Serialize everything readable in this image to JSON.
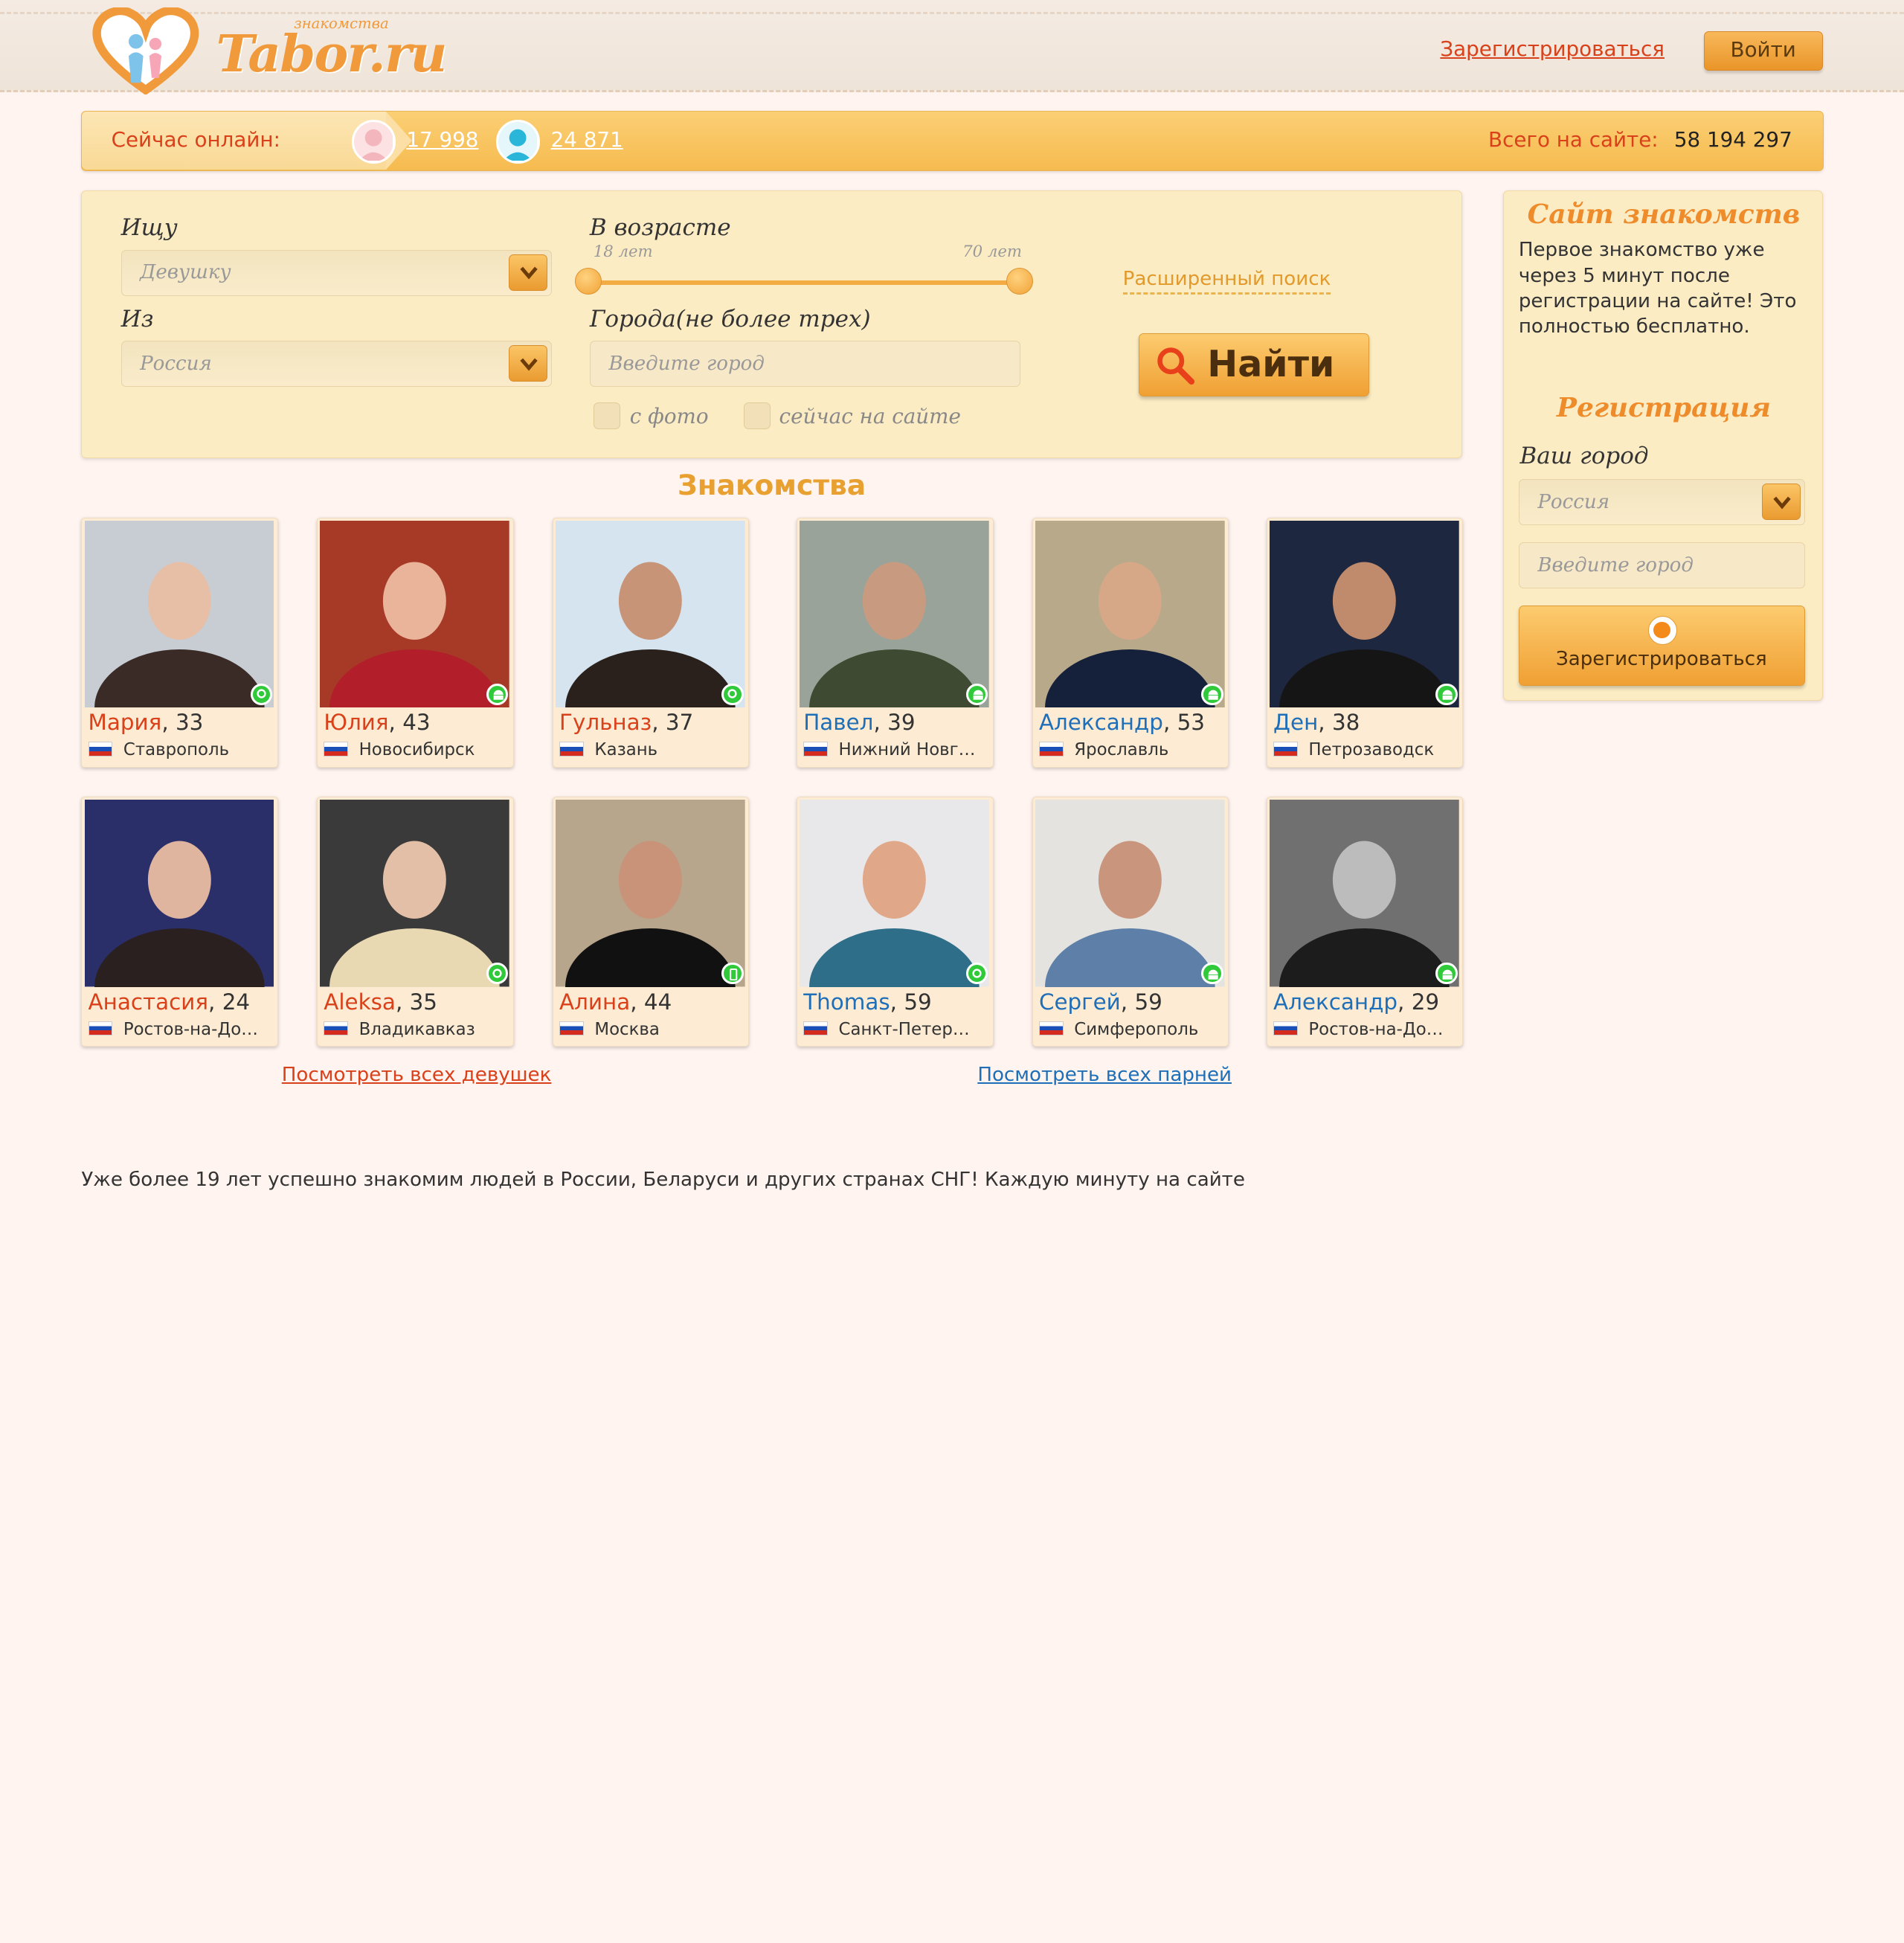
{
  "header": {
    "logo_word": "Tabor.ru",
    "logo_small": "знакомства",
    "register_link": "Зарегистрироваться",
    "login_button": "Войти"
  },
  "online_bar": {
    "label": "Сейчас онлайн:",
    "women_count": "17 998",
    "men_count": "24 871",
    "total_label": "Всего на сайте:",
    "total_value": "58 194 297"
  },
  "search": {
    "looking_label": "Ищу",
    "looking_value": "Девушку",
    "from_label": "Из",
    "from_value": "Россия",
    "age_label": "В возрасте",
    "age_min": "18 лет",
    "age_max": "70 лет",
    "cities_label": "Города(не более трех)",
    "city_placeholder": "Введите город",
    "with_photo": "с фото",
    "online_now": "сейчас на сайте",
    "advanced_link": "Расширенный поиск",
    "find_button": "Найти"
  },
  "section_title": "Знакомства",
  "profiles_row1": [
    {
      "name": "Мария",
      "age": ", 33",
      "city": "Ставрополь",
      "gender": "f",
      "status": "online"
    },
    {
      "name": "Юлия",
      "age": ", 43",
      "city": "Новосибирск",
      "gender": "f",
      "status": "android"
    },
    {
      "name": "Гульназ",
      "age": ", 37",
      "city": "Казань",
      "gender": "f",
      "status": "online"
    },
    {
      "name": "Павел",
      "age": ", 39",
      "city": "Нижний Новг…",
      "gender": "m",
      "status": "android"
    },
    {
      "name": "Александр",
      "age": ", 53",
      "city": "Ярославль",
      "gender": "m",
      "status": "android"
    },
    {
      "name": "Ден",
      "age": ", 38",
      "city": "Петрозаводск",
      "gender": "m",
      "status": "android"
    }
  ],
  "profiles_row2": [
    {
      "name": "Анастасия",
      "age": ", 24",
      "city": "Ростов-на-До…",
      "gender": "f",
      "status": "none"
    },
    {
      "name": "Aleksa",
      "age": ", 35",
      "city": "Владикавказ",
      "gender": "f",
      "status": "online"
    },
    {
      "name": "Алина",
      "age": ", 44",
      "city": "Москва",
      "gender": "f",
      "status": "mobile"
    },
    {
      "name": "Thomas",
      "age": ", 59",
      "city": "Санкт-Петер…",
      "gender": "m",
      "status": "online"
    },
    {
      "name": "Сергей",
      "age": ", 59",
      "city": "Симферополь",
      "gender": "m",
      "status": "android"
    },
    {
      "name": "Александр",
      "age": ", 29",
      "city": "Ростов-на-До…",
      "gender": "m",
      "status": "android"
    }
  ],
  "see_all_girls": "Посмотреть всех девушек",
  "see_all_guys": "Посмотреть всех парней",
  "sidebar": {
    "title": "Сайт знакомств",
    "text": "Первое знакомство уже через 5 минут после регистрации на сайте! Это полностью бесплатно.",
    "reg_title": "Регистрация",
    "city_label": "Ваш город",
    "country_value": "Россия",
    "city_placeholder": "Введите город",
    "register_button": "Зарегистрироваться"
  },
  "bottom_text": "Уже более 19 лет успешно знакомим людей в России, Беларуси и других странах СНГ! Каждую минуту на сайте",
  "colors": {
    "accent_orange": "#f0a033",
    "female_name": "#d9411b",
    "male_name": "#1f6fb8",
    "online_green": "#2fc93a"
  }
}
